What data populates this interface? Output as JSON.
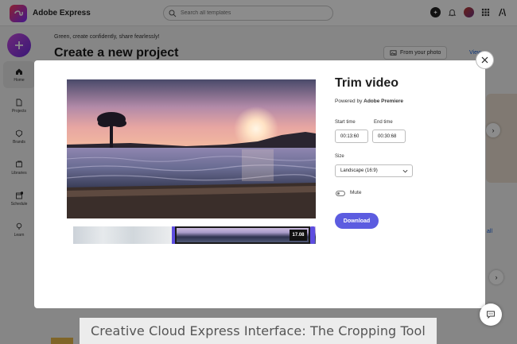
{
  "app": {
    "name": "Adobe Express"
  },
  "search": {
    "placeholder": "Search all templates"
  },
  "rail": {
    "items": [
      {
        "label": "Home"
      },
      {
        "label": "Projects"
      },
      {
        "label": "Brands"
      },
      {
        "label": "Libraries"
      },
      {
        "label": "Schedule"
      },
      {
        "label": "Learn"
      }
    ]
  },
  "main": {
    "greeting": "Green, create confidently, share fearlessly!",
    "title": "Create a new project",
    "from_photo": "From your photo",
    "view_all": "View",
    "see_all": "all"
  },
  "trim": {
    "title": "Trim video",
    "powered_prefix": "Powered by",
    "powered_brand": "Adobe Premiere",
    "start_label": "Start time",
    "start_value": "00:13:60",
    "end_label": "End time",
    "end_value": "00:30:68",
    "size_label": "Size",
    "size_value": "Landscape (16:9)",
    "mute_label": "Mute",
    "mute_on": false,
    "download_label": "Download",
    "clip_duration": "17.08"
  },
  "caption": "Creative Cloud Express Interface: The Cropping Tool",
  "colors": {
    "accent": "#5c5ce0",
    "create": "#8a3bdc"
  }
}
